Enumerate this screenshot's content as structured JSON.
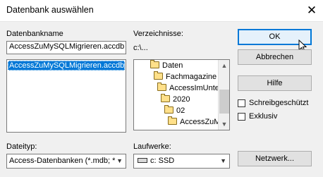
{
  "window": {
    "title": "Datenbank auswählen",
    "close_icon": "close-icon"
  },
  "left": {
    "db_name_label": "Datenbankname",
    "db_name_value": "AccessZuMySQLMigrieren.accdb",
    "files": [
      "AccessZuMySQLMigrieren.accdb"
    ],
    "file_type_label": "Dateityp:",
    "file_type_value": "Access-Datenbanken (*.mdb; *"
  },
  "middle": {
    "dirs_label": "Verzeichnisse:",
    "current_path": "c:\\...",
    "tree": [
      "Daten",
      "Fachmagazine",
      "AccessImUnte",
      "2020",
      "02",
      "AccessZuM"
    ],
    "drives_label": "Laufwerke:",
    "drive_value": "c: SSD"
  },
  "right": {
    "ok_label": "OK",
    "cancel_label": "Abbrechen",
    "help_label": "Hilfe",
    "readonly_label": "Schreibgeschützt",
    "exclusive_label": "Exklusiv",
    "network_label": "Netzwerk..."
  },
  "colors": {
    "selection": "#0078d7",
    "default_button_border": "#0078d7"
  }
}
